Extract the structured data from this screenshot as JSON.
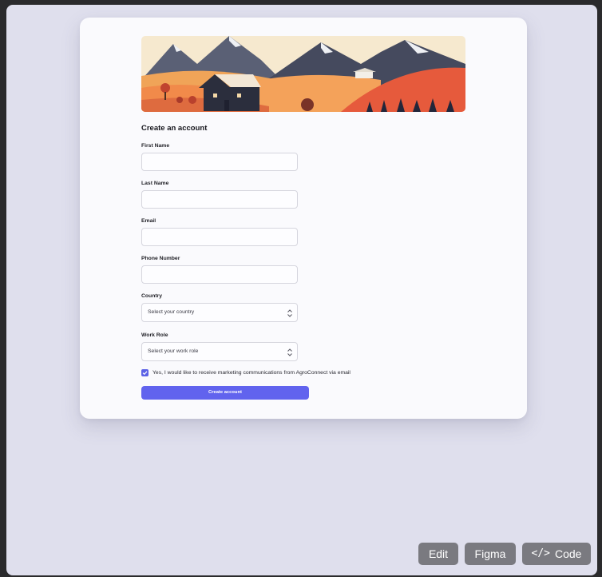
{
  "form": {
    "title": "Create an account",
    "fields": [
      {
        "label": "First Name",
        "value": ""
      },
      {
        "label": "Last Name",
        "value": ""
      },
      {
        "label": "Email",
        "value": ""
      },
      {
        "label": "Phone Number",
        "value": ""
      }
    ],
    "country": {
      "label": "Country",
      "placeholder": "Select your country"
    },
    "work_role": {
      "label": "Work Role",
      "placeholder": "Select your work role"
    },
    "consent": {
      "checked": true,
      "text": "Yes, I would like to receive marketing communications from AgroConnect via email"
    },
    "submit_label": "Create account"
  },
  "toolbar": {
    "edit_label": "Edit",
    "figma_label": "Figma",
    "code_label": "Code",
    "code_icon": "</>"
  },
  "colors": {
    "accent": "#6163ee",
    "page_background": "#dfdfed",
    "card_background": "#fafafd"
  }
}
